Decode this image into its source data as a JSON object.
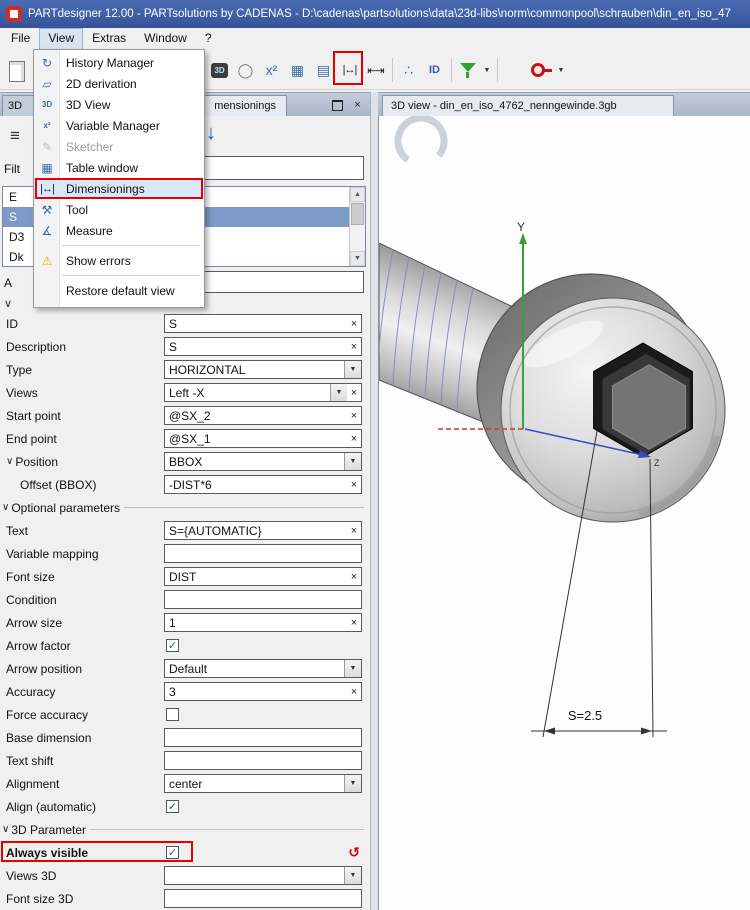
{
  "window": {
    "title": "PARTdesigner 12.00 - PARTsolutions by CADENAS - D:\\cadenas\\partsolutions\\data\\23d-libs\\norm\\commonpool\\schrauben\\din_en_iso_47"
  },
  "menu_bar": {
    "items": [
      {
        "label": "File"
      },
      {
        "label": "View",
        "active": true
      },
      {
        "label": "Extras"
      },
      {
        "label": "Window"
      },
      {
        "label": "?"
      }
    ]
  },
  "toolbar": {
    "left_icons": [
      {
        "name": "new-document-icon",
        "style": "page"
      }
    ],
    "icons": [
      {
        "name": "view-3d-icon",
        "glyph": "3D",
        "style": "dark-badge"
      },
      {
        "name": "derivation-2d-icon",
        "glyph": "◯",
        "style": "plain"
      },
      {
        "name": "variable-manager-icon",
        "glyph": "x²",
        "style": "plain-blue"
      },
      {
        "name": "table-window-icon",
        "glyph": "▦",
        "style": "plain-blue"
      },
      {
        "name": "form-icon",
        "glyph": "▤",
        "style": "plain-blue"
      },
      {
        "name": "dimensionings-icon",
        "glyph": "|↔|",
        "style": "dim"
      },
      {
        "name": "dimension-horizontal-icon",
        "glyph": "⇤⇥",
        "style": "dim"
      },
      {
        "separator": true
      },
      {
        "name": "connections-icon",
        "glyph": "∴",
        "style": "plain-blue"
      },
      {
        "name": "id-icon",
        "glyph": "ID",
        "style": "id"
      },
      {
        "separator": true
      },
      {
        "name": "filter-icon",
        "style": "funnel"
      },
      {
        "name": "filter-caret-icon",
        "glyph": "▼",
        "style": "caret"
      },
      {
        "separator": true
      },
      {
        "spacer": true
      },
      {
        "name": "key-icon",
        "style": "key"
      },
      {
        "name": "key-caret-icon",
        "glyph": "▼",
        "style": "caret"
      }
    ]
  },
  "view_menu": {
    "items": [
      {
        "label": "History Manager",
        "icon": "history-manager-icon",
        "glyph": "↻"
      },
      {
        "label": "2D derivation",
        "icon": "derivation-2d-icon",
        "glyph": "▱"
      },
      {
        "label": "3D View",
        "icon": "view-3d-icon",
        "glyph": "3D",
        "small": true
      },
      {
        "label": "Variable Manager",
        "icon": "variable-manager-icon",
        "glyph": "x²",
        "small": true
      },
      {
        "label": "Sketcher",
        "icon": "sketcher-icon",
        "glyph": "✎",
        "disabled": true
      },
      {
        "label": "Table window",
        "icon": "table-window-icon",
        "glyph": "▦"
      },
      {
        "label": "Dimensionings",
        "icon": "dimensionings-icon",
        "glyph": "|↔|",
        "dim": true,
        "highlighted": true,
        "annotated": true
      },
      {
        "label": "Tool",
        "icon": "tool-icon",
        "glyph": "⚒"
      },
      {
        "label": "Measure",
        "icon": "measure-icon",
        "glyph": "∡"
      },
      {
        "separator": true
      },
      {
        "label": "Show errors",
        "icon": "warning-icon",
        "glyph": "⚠",
        "warn": true
      },
      {
        "separator": true
      },
      {
        "label": "Restore default view",
        "icon": "no-icon",
        "glyph": ""
      }
    ]
  },
  "left_panel": {
    "tab_3d": "3D",
    "tab_title": "mensionings",
    "menu_icon": "≡",
    "arrow_icon": "↓",
    "filter_label": "Filt",
    "list_items": [
      {
        "id": "E"
      },
      {
        "id": "S",
        "selected": true
      },
      {
        "id": "D3"
      },
      {
        "id": "Dk"
      }
    ],
    "side_label": "A",
    "properties": [
      {
        "label": "ID",
        "value": "S",
        "control": "text-x"
      },
      {
        "label": "Description",
        "value": "S",
        "control": "text-x"
      },
      {
        "label": "Type",
        "value": "HORIZONTAL",
        "control": "dropdown"
      },
      {
        "label": "Views",
        "value": "Left -X",
        "control": "dropdown-x"
      },
      {
        "label": "Start point",
        "value": "@SX_2",
        "control": "text-x"
      },
      {
        "label": "End point",
        "value": "@SX_1",
        "control": "text-x"
      },
      {
        "label": "Position",
        "value": "BBOX",
        "control": "dropdown",
        "chevron": true
      },
      {
        "label": "Offset (BBOX)",
        "value": "-DIST*6",
        "control": "text-x",
        "indent": true
      },
      {
        "label": "Optional parameters",
        "control": "section",
        "chevron": true
      },
      {
        "label": "Text",
        "value": "S={AUTOMATIC}",
        "control": "text-x"
      },
      {
        "label": "Variable mapping",
        "value": "",
        "control": "text"
      },
      {
        "label": "Font size",
        "value": "DIST",
        "control": "text-x"
      },
      {
        "label": "Condition",
        "value": "",
        "control": "text"
      },
      {
        "label": "Arrow size",
        "value": "1",
        "control": "text-x"
      },
      {
        "label": "Arrow factor",
        "checked": true,
        "control": "checkbox"
      },
      {
        "label": "Arrow position",
        "value": "Default",
        "control": "dropdown"
      },
      {
        "label": "Accuracy",
        "value": "3",
        "control": "text-x"
      },
      {
        "label": "Force accuracy",
        "checked": false,
        "control": "checkbox"
      },
      {
        "label": "Base dimension",
        "value": "",
        "control": "text"
      },
      {
        "label": "Text shift",
        "value": "",
        "control": "text"
      },
      {
        "label": "Alignment",
        "value": "center",
        "control": "dropdown"
      },
      {
        "label": "Align (automatic)",
        "checked": true,
        "control": "checkbox"
      },
      {
        "label": "3D Parameter",
        "control": "section",
        "chevron": true
      },
      {
        "label": "Always visible",
        "checked": true,
        "control": "checkbox",
        "bold": true,
        "annotated": true,
        "reset": true
      },
      {
        "label": "Views 3D",
        "value": "",
        "control": "dropdown"
      },
      {
        "label": "Font size 3D",
        "value": "",
        "control": "text"
      }
    ]
  },
  "right_panel": {
    "tab_title": "3D view - din_en_iso_4762_nenngewinde.3gb",
    "viewport": {
      "axis_y": "Y",
      "axis_z": "Z",
      "dimension_label": "S=2.5"
    }
  },
  "glyphs": {
    "clear": "×",
    "close": "×",
    "dropdown": "▼",
    "check": "✓",
    "reset": "↺",
    "chevron": "∨",
    "scroll_up": "▲",
    "scroll_down": "▼"
  },
  "colors": {
    "annotation": "#e80000",
    "accent_blue": "#3a6ea5",
    "selection": "#7d9bc8"
  }
}
